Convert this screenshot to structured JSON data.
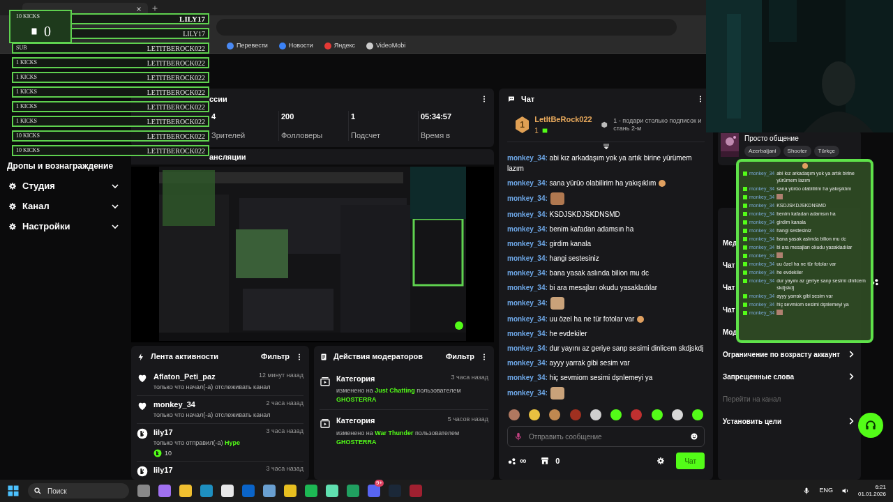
{
  "browser": {
    "bookmarks": [
      {
        "label": "Перевести",
        "color": "#4a8af4"
      },
      {
        "label": "Новости",
        "color": "#3b82f6"
      },
      {
        "label": "Яндекс",
        "color": "#e53935"
      },
      {
        "label": "VideoMobi",
        "color": "#cccccc"
      }
    ]
  },
  "alerts": {
    "counter": {
      "label": "10 KICKS",
      "count": "0"
    },
    "rows": [
      {
        "kind": "latest",
        "label": "",
        "name": "LILY17"
      },
      {
        "kind": "entry",
        "label": "",
        "name": "LILY17"
      },
      {
        "kind": "entry",
        "label": "SUB",
        "name": "LETITBEROCK022"
      },
      {
        "kind": "entry",
        "label": "1 KICKS",
        "name": "LETITBEROCK022"
      },
      {
        "kind": "entry",
        "label": "1 KICKS",
        "name": "LETITBEROCK022"
      },
      {
        "kind": "entry",
        "label": "1 KICKS",
        "name": "LETITBEROCK022"
      },
      {
        "kind": "entry",
        "label": "1 KICKS",
        "name": "LETITBEROCK022"
      },
      {
        "kind": "entry",
        "label": "1 KICKS",
        "name": "LETITBEROCK022"
      },
      {
        "kind": "entry",
        "label": "10 KICKS",
        "name": "LETITBEROCK022"
      },
      {
        "kind": "entry",
        "label": "10 KICKS",
        "name": "LETITBEROCK022"
      }
    ]
  },
  "sidebar": {
    "items": [
      {
        "label": "Дропы и вознаграждение",
        "kind": "plain"
      },
      {
        "label": "Студия",
        "kind": "group",
        "expanded": false
      },
      {
        "label": "Канал",
        "kind": "group",
        "expanded": false
      },
      {
        "label": "Настройки",
        "kind": "group",
        "expanded": false
      }
    ]
  },
  "stats": {
    "title": "ссии",
    "items": [
      {
        "value": "4",
        "label": "Зрителей"
      },
      {
        "value": "200",
        "label": "Фолловеры"
      },
      {
        "value": "1",
        "label": "Подсчет"
      },
      {
        "value": "05:34:57",
        "label": "Время в"
      }
    ]
  },
  "preview": {
    "title": "ансляции"
  },
  "activity": {
    "title": "Лента активности",
    "filter": "Фильтр",
    "items": [
      {
        "kind": "follow",
        "user": "Aflaton_Peti_paz",
        "time": "12 минут назад",
        "text": "только что начал(-а) отслеживать канал"
      },
      {
        "kind": "follow",
        "user": "monkey_34",
        "time": "2 часа назад",
        "text": "только что начал(-а) отслеживать канал"
      },
      {
        "kind": "kicks",
        "user": "lily17",
        "time": "3 часа назад",
        "text": "только что отправил(-а)",
        "highlight": "Hype",
        "amount": "10"
      },
      {
        "kind": "kicks",
        "user": "lily17",
        "time": "3 часа назад"
      }
    ]
  },
  "mod_actions": {
    "title": "Действия модераторов",
    "filter": "Фильтр",
    "items": [
      {
        "title": "Категория",
        "time": "3 часа назад",
        "prefix": "изменено на",
        "value": "Just Chatting",
        "suffix": "пользователем",
        "by": "GHOSTERRA"
      },
      {
        "title": "Категория",
        "time": "5 часов назад",
        "prefix": "изменено на",
        "value": "War Thunder",
        "suffix": "пользователем",
        "by": "GHOSTERRA"
      }
    ]
  },
  "chat": {
    "title": "Чат",
    "top_gifter": {
      "rank": "1",
      "name": "LetItBeRock022",
      "count": "1",
      "hint": "1 - подари столько подписок и стань 2-м"
    },
    "messages": [
      {
        "kind": "text",
        "user": "monkey_34:",
        "text": "abi kız arkadaşım yok ya artık birine yürümem lazım",
        "emote": false
      },
      {
        "kind": "text",
        "user": "monkey_34:",
        "text": "sana yürüo olabilirim ha yakışıklım",
        "emote": true
      },
      {
        "kind": "emote",
        "user": "monkey_34:"
      },
      {
        "kind": "text",
        "user": "monkey_34:",
        "text": "KSDJSKDJSKDNSMD",
        "emote": false
      },
      {
        "kind": "text",
        "user": "monkey_34:",
        "text": "benim kafadan adamsın ha",
        "emote": false
      },
      {
        "kind": "text",
        "user": "monkey_34:",
        "text": "girdim kanala",
        "emote": false
      },
      {
        "kind": "text",
        "user": "monkey_34:",
        "text": "hangi sestesiniz",
        "emote": false
      },
      {
        "kind": "text",
        "user": "monkey_34:",
        "text": "bana yasak aslında bilion mu dc",
        "emote": false
      },
      {
        "kind": "text",
        "user": "monkey_34:",
        "text": "bi ara mesajları okudu yasakladılar",
        "emote": false
      },
      {
        "kind": "emote",
        "user": "monkey_34:"
      },
      {
        "kind": "text",
        "user": "monkey_34:",
        "text": "uu özel ha ne tür fotolar var",
        "emote": true
      },
      {
        "kind": "text",
        "user": "monkey_34:",
        "text": "he evdekiler",
        "emote": false
      },
      {
        "kind": "text",
        "user": "monkey_34:",
        "text": "dur yayını az geriye sanp sesimi dinlicem skdjskdj",
        "emote": false
      },
      {
        "kind": "text",
        "user": "monkey_34:",
        "text": "ayyy yarrak gibi sesim var",
        "emote": false
      },
      {
        "kind": "text",
        "user": "monkey_34:",
        "text": "hiç sevmiom sesimi dşnlemeyi ya",
        "emote": false
      },
      {
        "kind": "emote",
        "user": "monkey_34:"
      }
    ],
    "placeholder": "Отправить сообщение",
    "points": "∞",
    "store_count": "0",
    "send": "Чат"
  },
  "stream_card": {
    "title": "Просто общение",
    "tags": [
      "Azerbaijani",
      "Shooter",
      "Türkçe"
    ]
  },
  "settings": [
    {
      "kind": "stub",
      "label": "Мед",
      "disabled": false
    },
    {
      "kind": "stub",
      "label": "Чат",
      "disabled": false
    },
    {
      "kind": "stub",
      "label": "Чат",
      "disabled": false
    },
    {
      "kind": "stub",
      "label": "Чат",
      "disabled": false
    },
    {
      "kind": "stub",
      "label": "Мод",
      "disabled": false
    },
    {
      "kind": "link",
      "label": "Ограничение по возрасту аккаунт",
      "disabled": false
    },
    {
      "kind": "link",
      "label": "Запрещенные слова",
      "disabled": false
    },
    {
      "kind": "plain",
      "label": "Перейти на канал",
      "disabled": true
    },
    {
      "kind": "link",
      "label": "Установить цели",
      "disabled": false
    }
  ],
  "chat_overlay": [
    {
      "kind": "text",
      "user": "monkey_34",
      "text": "abi kız arkadaşım yok ya artık birine yürümem lazım"
    },
    {
      "kind": "text",
      "user": "monkey_34",
      "text": "sana yürüo olabilirim ha yakışıklım"
    },
    {
      "kind": "emote",
      "user": "monkey_34"
    },
    {
      "kind": "text",
      "user": "monkey_34",
      "text": "KSDJSKDJSKDNSMD"
    },
    {
      "kind": "text",
      "user": "monkey_34",
      "text": "benim kafadan adamsın ha"
    },
    {
      "kind": "text",
      "user": "monkey_34",
      "text": "girdim kanala"
    },
    {
      "kind": "text",
      "user": "monkey_34",
      "text": "hangi sestesiniz"
    },
    {
      "kind": "text",
      "user": "monkey_34",
      "text": "bana yasak aslında bilion mu dc"
    },
    {
      "kind": "text",
      "user": "monkey_34",
      "text": "bi ara mesajları okudu yasakladılar"
    },
    {
      "kind": "emote",
      "user": "monkey_34"
    },
    {
      "kind": "text",
      "user": "monkey_34",
      "text": "uu özel ha ne tür fotolar var"
    },
    {
      "kind": "text",
      "user": "monkey_34",
      "text": "he evdekiler"
    },
    {
      "kind": "text",
      "user": "monkey_34",
      "text": "dur yayını az geriye sanp sesimi dinlicem skdjskdj"
    },
    {
      "kind": "text",
      "user": "monkey_34",
      "text": "ayyy yarrak gibi sesim var"
    },
    {
      "kind": "text",
      "user": "monkey_34",
      "text": "hiç sevmiom sesimi dşnlemeyi ya"
    },
    {
      "kind": "emote",
      "user": "monkey_34"
    }
  ],
  "taskbar": {
    "search": "Поиск",
    "badge": "9+",
    "language": "ENG",
    "time": "6:21",
    "date": "01.01.2026"
  }
}
